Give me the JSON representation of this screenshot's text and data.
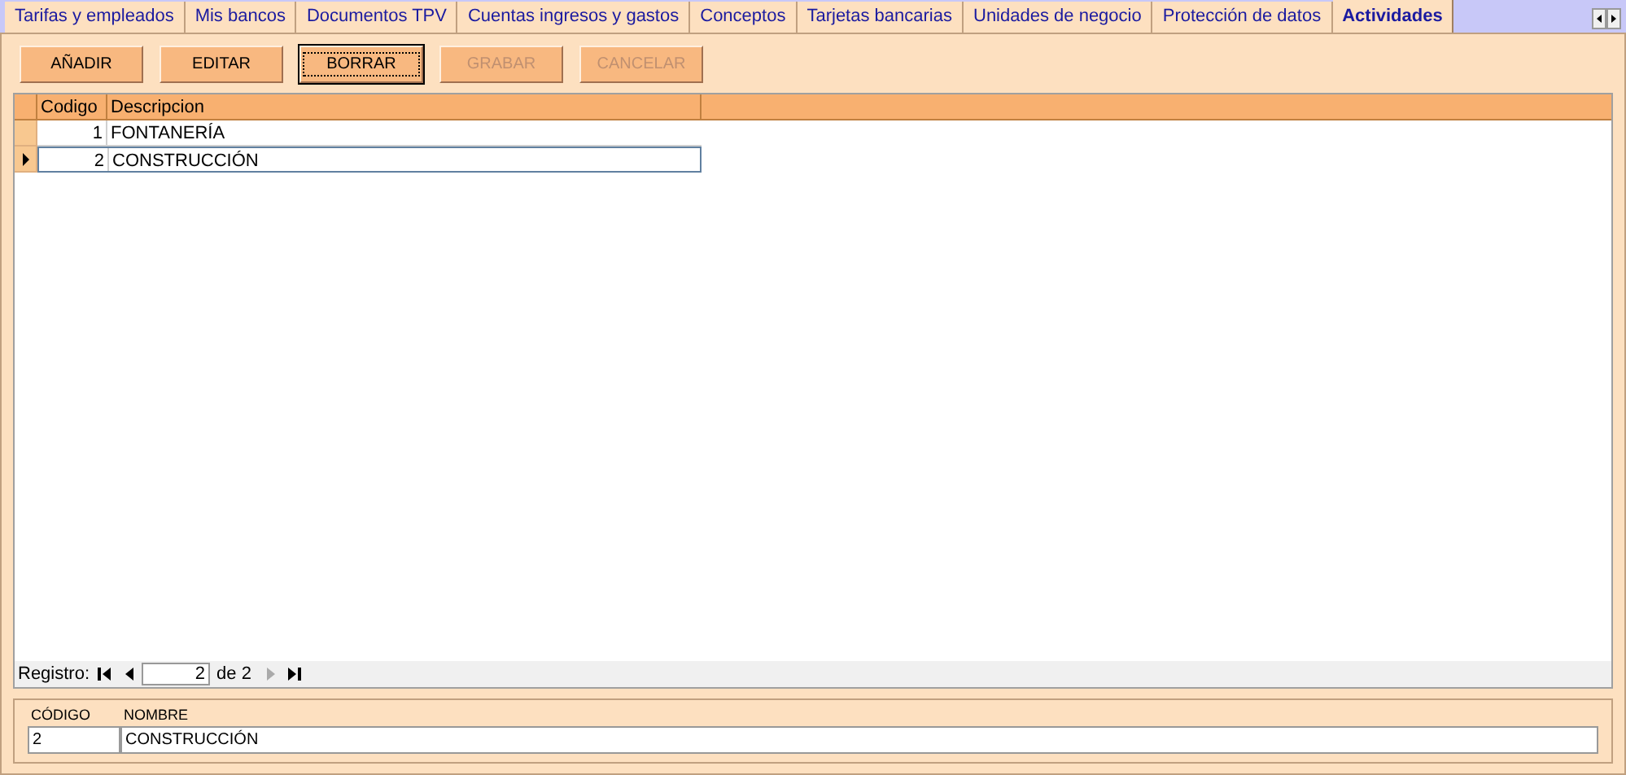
{
  "tabs": [
    {
      "label": "Tarifas y empleados",
      "selected": false
    },
    {
      "label": "Mis bancos",
      "selected": false
    },
    {
      "label": "Documentos TPV",
      "selected": false
    },
    {
      "label": "Cuentas ingresos y gastos",
      "selected": false
    },
    {
      "label": "Conceptos",
      "selected": false
    },
    {
      "label": "Tarjetas bancarias",
      "selected": false
    },
    {
      "label": "Unidades de negocio",
      "selected": false
    },
    {
      "label": "Protección de datos",
      "selected": false
    },
    {
      "label": "Actividades",
      "selected": true
    }
  ],
  "buttons": [
    {
      "label": "AÑADIR",
      "disabled": false,
      "focused": false
    },
    {
      "label": "EDITAR",
      "disabled": false,
      "focused": false
    },
    {
      "label": "BORRAR",
      "disabled": false,
      "focused": true
    },
    {
      "label": "GRABAR",
      "disabled": true,
      "focused": false
    },
    {
      "label": "CANCELAR",
      "disabled": true,
      "focused": false
    }
  ],
  "table": {
    "columns": [
      "Codigo",
      "Descripcion"
    ],
    "rows": [
      {
        "cells": [
          "1",
          "FONTANERÍA"
        ],
        "selected": false
      },
      {
        "cells": [
          "2",
          "CONSTRUCCIÓN"
        ],
        "selected": true
      }
    ]
  },
  "navigator": {
    "label": "Registro:",
    "current": "2",
    "total": "de 2"
  },
  "detail": {
    "fields": [
      {
        "label": "CÓDIGO",
        "value": "2"
      },
      {
        "label": "NOMBRE",
        "value": "CONSTRUCCIÓN"
      }
    ]
  }
}
